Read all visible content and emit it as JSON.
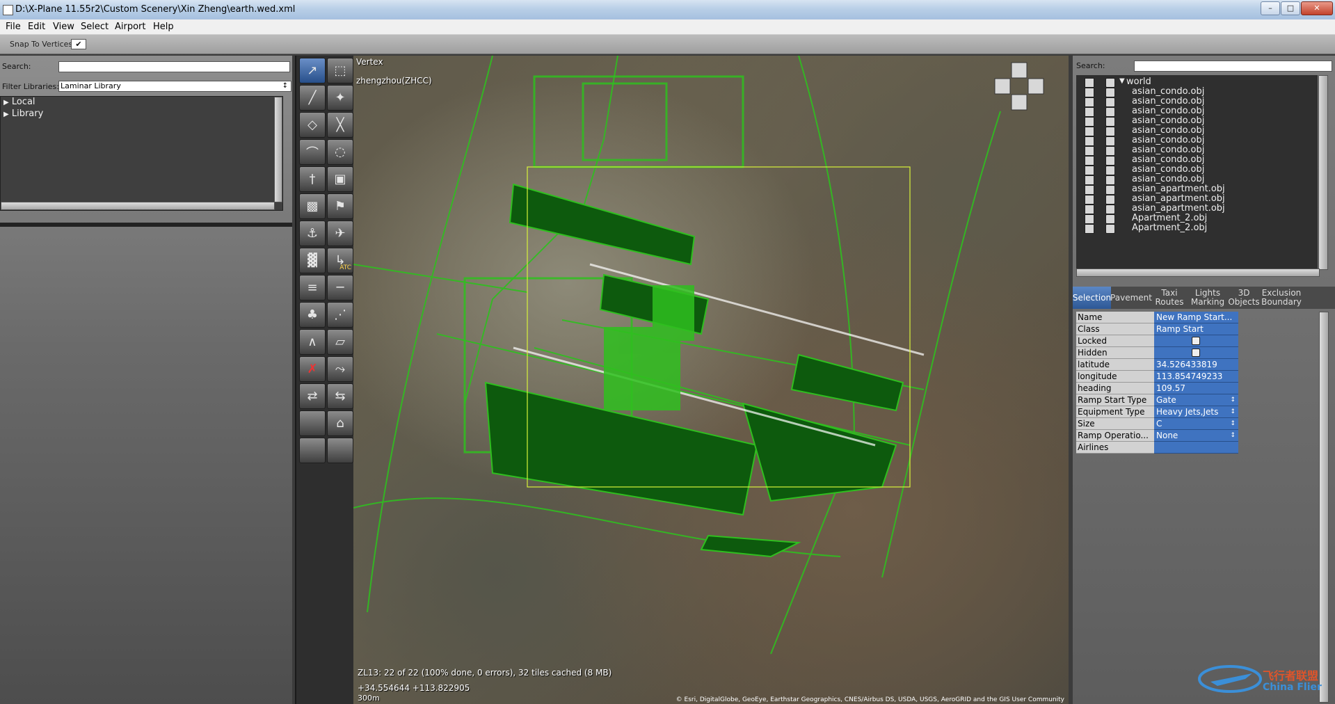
{
  "window": {
    "title": "D:\\X-Plane 11.55r2\\Custom Scenery\\Xin Zheng\\earth.wed.xml",
    "controls": [
      "–",
      "□",
      "✕"
    ]
  },
  "menu": [
    "File",
    "Edit",
    "View",
    "Select",
    "Airport",
    "Help"
  ],
  "toolbar": {
    "snap_label": "Snap To Vertices",
    "snap_checked": "✔"
  },
  "left_panel": {
    "search_label": "Search:",
    "search_value": "",
    "filter_label": "Filter Libraries:",
    "filter_value": "Laminar Library",
    "filter_arrow": "↕",
    "tree": [
      {
        "label": "Local",
        "expander": "▶"
      },
      {
        "label": "Library",
        "expander": "▶"
      }
    ]
  },
  "palette": {
    "tools": [
      "select-arrow-icon",
      "marquee-icon",
      "runway-icon",
      "helipad-icon",
      "taxiway-icon",
      "sealane-icon",
      "taxiline-icon",
      "boundary-icon",
      "light-icon",
      "sign-icon",
      "object-icon",
      "windsock-icon",
      "tower-beacon-icon",
      "ramp-start-icon",
      "facade-icon",
      "atc-icon",
      "forest-icon",
      "line-icon",
      "tree-icon",
      "string-icon",
      "polygon-line-icon",
      "draped-polygon-icon",
      "exclusion-icon",
      "road-icon",
      "taxi-route-icon",
      "traffic-icon",
      "empty-tool-icon",
      "autogen-icon",
      "empty-tool-icon-2",
      "empty-tool-icon-3"
    ],
    "atc_label": "ATC"
  },
  "map": {
    "tool_label": "Vertex",
    "airport_label": "zhengzhou(ZHCC)",
    "status_line": "ZL13: 22 of 22 (100% done, 0 errors), 32 tiles cached (8 MB)",
    "coordinates": "+34.554644 +113.822905",
    "scale": "300m",
    "attribution": "© Esri, DigitalGlobe, GeoEye, Earthstar Geographics, CNES/Airbus DS, USDA, USGS, AeroGRID and the GIS User Community",
    "colors": {
      "overlay_green": "#2fbf1f",
      "dark_fill": "#0d5a0d",
      "bounds": "#d8f23a"
    }
  },
  "right_panel": {
    "search_label": "Search:",
    "search_value": "",
    "hierarchy": [
      {
        "name": "world",
        "expander": "▼"
      },
      {
        "name": "asian_condo.obj"
      },
      {
        "name": "asian_condo.obj"
      },
      {
        "name": "asian_condo.obj"
      },
      {
        "name": "asian_condo.obj"
      },
      {
        "name": "asian_condo.obj"
      },
      {
        "name": "asian_condo.obj"
      },
      {
        "name": "asian_condo.obj"
      },
      {
        "name": "asian_condo.obj"
      },
      {
        "name": "asian_condo.obj"
      },
      {
        "name": "asian_condo.obj"
      },
      {
        "name": "asian_apartment.obj"
      },
      {
        "name": "asian_apartment.obj"
      },
      {
        "name": "asian_apartment.obj"
      },
      {
        "name": "Apartment_2.obj"
      },
      {
        "name": "Apartment_2.obj"
      }
    ],
    "tabs": [
      {
        "label": "Selection",
        "active": true
      },
      {
        "label": "Pavement"
      },
      {
        "label": "Taxi\nRoutes"
      },
      {
        "label": "Lights\nMarking"
      },
      {
        "label": "3D\nObjects"
      },
      {
        "label": "Exclusion\nBoundary"
      }
    ],
    "properties": [
      {
        "key": "Name",
        "value": "New Ramp Start..."
      },
      {
        "key": "Class",
        "value": "Ramp Start"
      },
      {
        "key": "Locked",
        "value": "",
        "icon": "lock-icon"
      },
      {
        "key": "Hidden",
        "value": "",
        "icon": "eye-icon"
      },
      {
        "key": "latitude",
        "value": " 34.526433819"
      },
      {
        "key": "longitude",
        "value": " 113.854749233"
      },
      {
        "key": "heading",
        "value": "109.57"
      },
      {
        "key": "Ramp Start Type",
        "value": "Gate",
        "dropdown": true
      },
      {
        "key": "Equipment Type",
        "value": "Heavy Jets,Jets",
        "dropdown": true
      },
      {
        "key": "Size",
        "value": "C",
        "dropdown": true
      },
      {
        "key": "Ramp Operatio...",
        "value": "None",
        "dropdown": true
      },
      {
        "key": "Airlines",
        "value": ""
      }
    ]
  },
  "watermark": {
    "cn": "飞行者联盟",
    "en": "China Flier"
  }
}
